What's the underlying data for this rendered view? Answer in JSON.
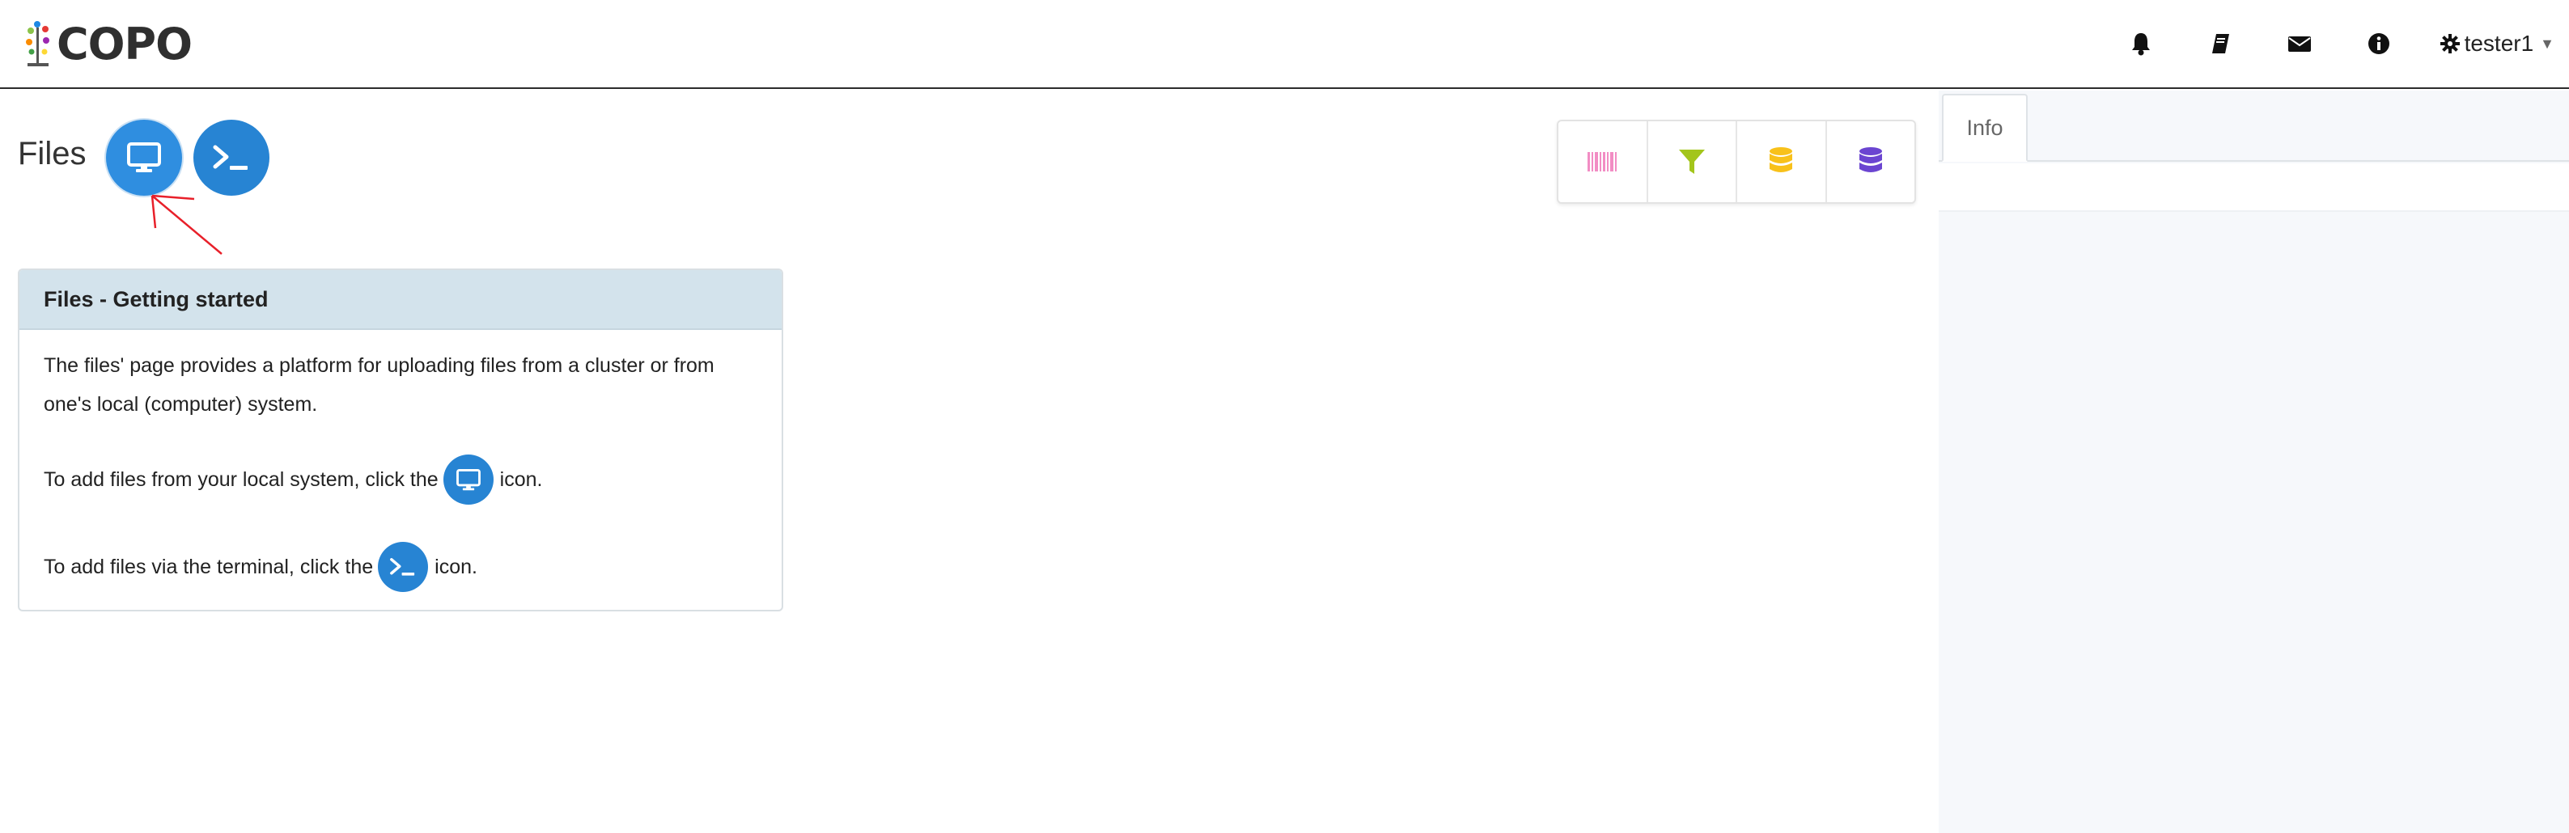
{
  "app": {
    "name": "COPO"
  },
  "nav": {
    "icons": [
      "bell-icon",
      "book-icon",
      "envelope-icon",
      "info-icon"
    ],
    "user": {
      "name": "tester1",
      "icon": "gear-icon"
    }
  },
  "page": {
    "title": "Files",
    "buttons": [
      {
        "name": "local-upload",
        "icon": "desktop-icon"
      },
      {
        "name": "terminal-upload",
        "icon": "terminal-icon"
      }
    ]
  },
  "filters": [
    {
      "icon": "barcode-icon",
      "color": "#f28dc4"
    },
    {
      "icon": "filter-icon",
      "color": "#a3c51b"
    },
    {
      "icon": "database-icon",
      "color": "#f8c11a"
    },
    {
      "icon": "database-icon",
      "color": "#6b45d1"
    }
  ],
  "panel": {
    "title": "Files - Getting started",
    "intro": "The files' page provides a platform for uploading files from a cluster or from one's local (computer) system.",
    "local_prefix": "To add files from your local system, click the",
    "local_suffix": "icon.",
    "terminal_prefix": "To add files via the terminal, click the",
    "terminal_suffix": "icon."
  },
  "sidebar": {
    "tab": "Info"
  },
  "colors": {
    "primary": "#2784d3",
    "panel_header": "#d3e3ec",
    "annotation": "#e8202a"
  }
}
